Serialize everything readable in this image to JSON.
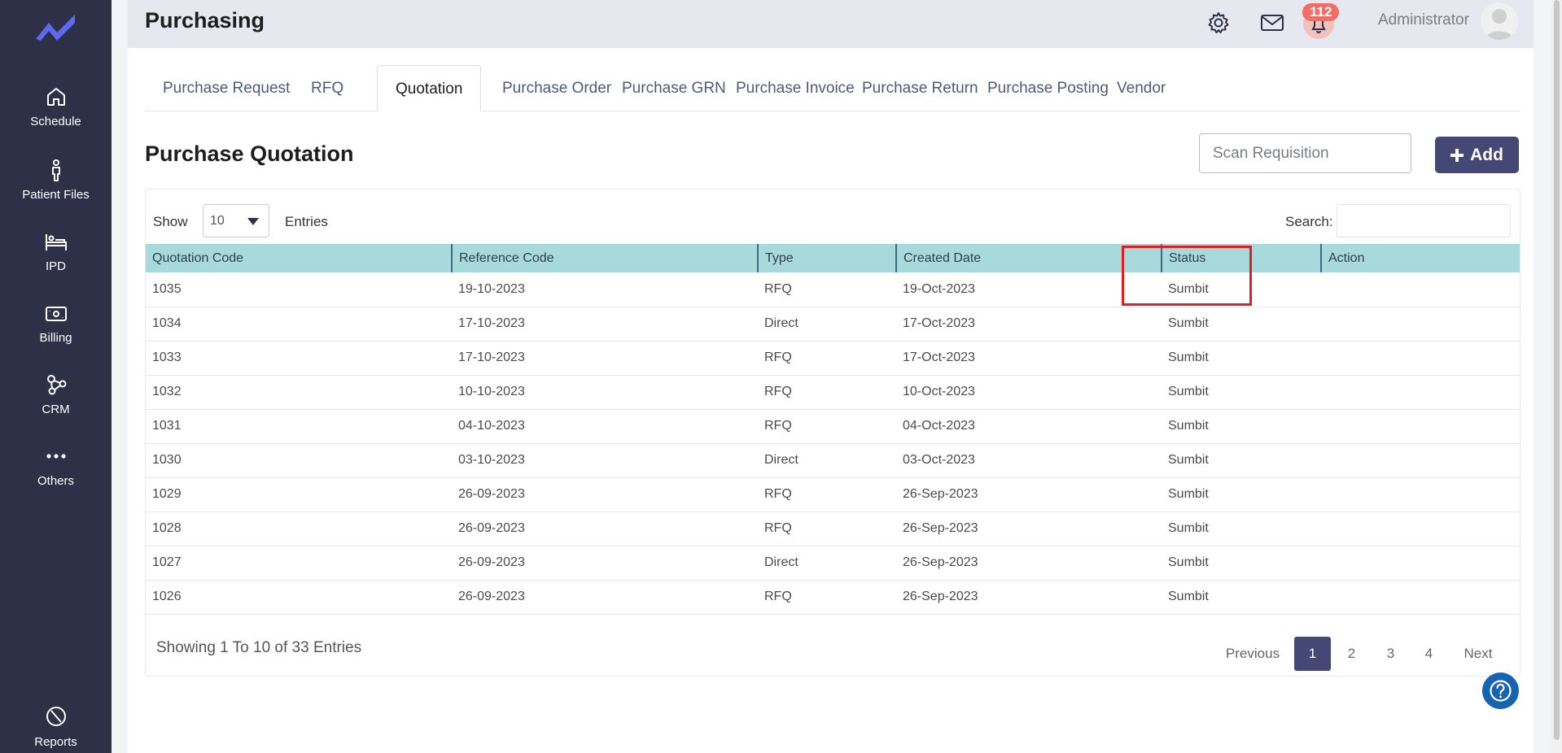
{
  "sidebar": {
    "items": [
      {
        "label": "Schedule",
        "icon": "home-icon"
      },
      {
        "label": "Patient Files",
        "icon": "person-icon"
      },
      {
        "label": "IPD",
        "icon": "bed-icon"
      },
      {
        "label": "Billing",
        "icon": "money-icon"
      },
      {
        "label": "CRM",
        "icon": "network-icon"
      },
      {
        "label": "Others",
        "icon": "more-icon"
      }
    ],
    "reports": {
      "label": "Reports",
      "icon": "pie-chart-icon"
    }
  },
  "header": {
    "title": "Purchasing",
    "notification_count": "112",
    "user_name": "Administrator"
  },
  "tabs": [
    {
      "label": "Purchase Request"
    },
    {
      "label": "RFQ"
    },
    {
      "label": "Quotation",
      "active": true
    },
    {
      "label": "Purchase Order"
    },
    {
      "label": "Purchase GRN"
    },
    {
      "label": "Purchase Invoice"
    },
    {
      "label": "Purchase Return"
    },
    {
      "label": "Purchase Posting"
    },
    {
      "label": "Vendor"
    }
  ],
  "section": {
    "title": "Purchase Quotation",
    "scan_placeholder": "Scan Requisition",
    "add_label": "Add"
  },
  "table_controls": {
    "show_label": "Show",
    "entries_value": "10",
    "entries_label": "Entries",
    "search_label": "Search:"
  },
  "table": {
    "columns": [
      "Quotation Code",
      "Reference Code",
      "Type",
      "Created Date",
      "Status",
      "Action"
    ],
    "rows": [
      [
        "1035",
        "19-10-2023",
        "RFQ",
        "19-Oct-2023",
        "Sumbit",
        ""
      ],
      [
        "1034",
        "17-10-2023",
        "Direct",
        "17-Oct-2023",
        "Sumbit",
        ""
      ],
      [
        "1033",
        "17-10-2023",
        "RFQ",
        "17-Oct-2023",
        "Sumbit",
        ""
      ],
      [
        "1032",
        "10-10-2023",
        "RFQ",
        "10-Oct-2023",
        "Sumbit",
        ""
      ],
      [
        "1031",
        "04-10-2023",
        "RFQ",
        "04-Oct-2023",
        "Sumbit",
        ""
      ],
      [
        "1030",
        "03-10-2023",
        "Direct",
        "03-Oct-2023",
        "Sumbit",
        ""
      ],
      [
        "1029",
        "26-09-2023",
        "RFQ",
        "26-Sep-2023",
        "Sumbit",
        ""
      ],
      [
        "1028",
        "26-09-2023",
        "RFQ",
        "26-Sep-2023",
        "Sumbit",
        ""
      ],
      [
        "1027",
        "26-09-2023",
        "Direct",
        "26-Sep-2023",
        "Sumbit",
        ""
      ],
      [
        "1026",
        "26-09-2023",
        "RFQ",
        "26-Sep-2023",
        "Sumbit",
        ""
      ]
    ]
  },
  "pagination": {
    "info": "Showing 1 To 10 of 33 Entries",
    "previous": "Previous",
    "pages": [
      "1",
      "2",
      "3",
      "4"
    ],
    "current": "1",
    "next": "Next"
  },
  "colors": {
    "sidebar_bg": "#2d3047",
    "accent": "#454775",
    "table_header_bg": "#a9dadb",
    "badge": "#ef6f66",
    "highlight": "#e02020"
  }
}
